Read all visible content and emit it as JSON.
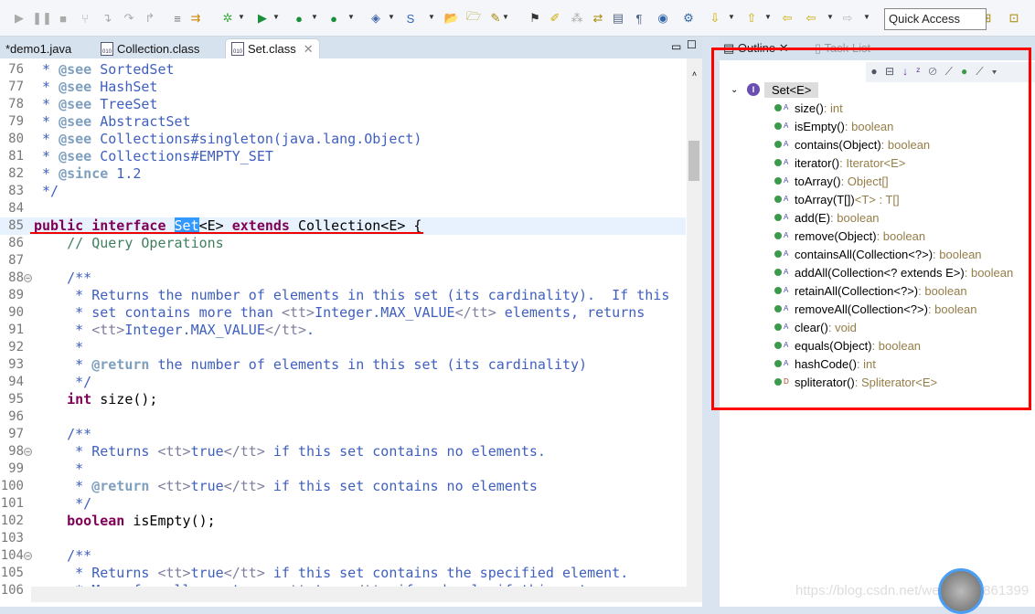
{
  "toolbar": {
    "quick_access": "Quick Access"
  },
  "editor_tabs": [
    {
      "label": "*demo1.java"
    },
    {
      "label": "Collection.class"
    },
    {
      "label": "Set.class",
      "active": true
    }
  ],
  "outline": {
    "tab_outline": "Outline",
    "tab_tasks": "Task List",
    "root": "Set<E>",
    "methods": [
      {
        "name": "size()",
        "ret": " : int"
      },
      {
        "name": "isEmpty()",
        "ret": " : boolean"
      },
      {
        "name": "contains(Object)",
        "ret": " : boolean"
      },
      {
        "name": "iterator()",
        "ret": " : Iterator<E>"
      },
      {
        "name": "toArray()",
        "ret": " : Object[]"
      },
      {
        "name": "toArray(T[])",
        "ret": " <T> : T[]"
      },
      {
        "name": "add(E)",
        "ret": " : boolean"
      },
      {
        "name": "remove(Object)",
        "ret": " : boolean"
      },
      {
        "name": "containsAll(Collection<?>)",
        "ret": " : boolean"
      },
      {
        "name": "addAll(Collection<? extends E>)",
        "ret": " : boolean"
      },
      {
        "name": "retainAll(Collection<?>)",
        "ret": " : boolean"
      },
      {
        "name": "removeAll(Collection<?>)",
        "ret": " : boolean"
      },
      {
        "name": "clear()",
        "ret": " : void"
      },
      {
        "name": "equals(Object)",
        "ret": " : boolean"
      },
      {
        "name": "hashCode()",
        "ret": " : int"
      },
      {
        "name": "spliterator()",
        "ret": " : Spliterator<E>",
        "default": true
      }
    ]
  },
  "code": [
    {
      "n": "76",
      "s": [
        [
          "c",
          " * "
        ],
        [
          "g",
          "@see"
        ],
        [
          "c",
          " SortedSet"
        ]
      ]
    },
    {
      "n": "77",
      "s": [
        [
          "c",
          " * "
        ],
        [
          "g",
          "@see"
        ],
        [
          "c",
          " HashSet"
        ]
      ]
    },
    {
      "n": "78",
      "s": [
        [
          "c",
          " * "
        ],
        [
          "g",
          "@see"
        ],
        [
          "c",
          " TreeSet"
        ]
      ]
    },
    {
      "n": "79",
      "s": [
        [
          "c",
          " * "
        ],
        [
          "g",
          "@see"
        ],
        [
          "c",
          " AbstractSet"
        ]
      ]
    },
    {
      "n": "80",
      "s": [
        [
          "c",
          " * "
        ],
        [
          "g",
          "@see"
        ],
        [
          "c",
          " Collections#singleton(java.lang.Object)"
        ]
      ]
    },
    {
      "n": "81",
      "s": [
        [
          "c",
          " * "
        ],
        [
          "g",
          "@see"
        ],
        [
          "c",
          " Collections#EMPTY_SET"
        ]
      ]
    },
    {
      "n": "82",
      "s": [
        [
          "c",
          " * "
        ],
        [
          "g",
          "@since"
        ],
        [
          "c",
          " 1.2"
        ]
      ]
    },
    {
      "n": "83",
      "s": [
        [
          "c",
          " */"
        ]
      ]
    },
    {
      "n": "84",
      "s": []
    },
    {
      "n": "85",
      "cur": true,
      "s": [
        [
          "k",
          "public"
        ],
        [
          "t",
          " "
        ],
        [
          "k",
          "interface"
        ],
        [
          "t",
          " "
        ],
        [
          "sel",
          "Set"
        ],
        [
          "t",
          "<E> "
        ],
        [
          "k",
          "extends"
        ],
        [
          "t",
          " Collection<E> {"
        ]
      ]
    },
    {
      "n": "86",
      "s": [
        [
          "lc",
          "    // Query Operations"
        ]
      ]
    },
    {
      "n": "87",
      "s": []
    },
    {
      "n": "88",
      "fold": true,
      "s": [
        [
          "c",
          "    /**"
        ]
      ]
    },
    {
      "n": "89",
      "s": [
        [
          "c",
          "     * Returns the number of elements in this set (its cardinality).  If this"
        ]
      ]
    },
    {
      "n": "90",
      "s": [
        [
          "c",
          "     * set contains more than "
        ],
        [
          "h",
          "<tt>"
        ],
        [
          "c",
          "Integer.MAX_VALUE"
        ],
        [
          "h",
          "</tt>"
        ],
        [
          "c",
          " elements, returns"
        ]
      ]
    },
    {
      "n": "91",
      "s": [
        [
          "c",
          "     * "
        ],
        [
          "h",
          "<tt>"
        ],
        [
          "c",
          "Integer.MAX_VALUE"
        ],
        [
          "h",
          "</tt>"
        ],
        [
          "c",
          "."
        ]
      ]
    },
    {
      "n": "92",
      "s": [
        [
          "c",
          "     *"
        ]
      ]
    },
    {
      "n": "93",
      "s": [
        [
          "c",
          "     * "
        ],
        [
          "g",
          "@return"
        ],
        [
          "c",
          " the number of elements in this set (its cardinality)"
        ]
      ]
    },
    {
      "n": "94",
      "s": [
        [
          "c",
          "     */"
        ]
      ]
    },
    {
      "n": "95",
      "s": [
        [
          "t",
          "    "
        ],
        [
          "k",
          "int"
        ],
        [
          "t",
          " size();"
        ]
      ]
    },
    {
      "n": "96",
      "s": []
    },
    {
      "n": "97",
      "s": [
        [
          "c",
          "    /**"
        ]
      ]
    },
    {
      "n": "98",
      "fold": true,
      "s": [
        [
          "c",
          "     * Returns "
        ],
        [
          "h",
          "<tt>"
        ],
        [
          "c",
          "true"
        ],
        [
          "h",
          "</tt>"
        ],
        [
          "c",
          " if this set contains no elements."
        ]
      ]
    },
    {
      "n": "99",
      "s": [
        [
          "c",
          "     *"
        ]
      ]
    },
    {
      "n": "100",
      "s": [
        [
          "c",
          "     * "
        ],
        [
          "g",
          "@return"
        ],
        [
          "c",
          " "
        ],
        [
          "h",
          "<tt>"
        ],
        [
          "c",
          "true"
        ],
        [
          "h",
          "</tt>"
        ],
        [
          "c",
          " if this set contains no elements"
        ]
      ]
    },
    {
      "n": "101",
      "s": [
        [
          "c",
          "     */"
        ]
      ]
    },
    {
      "n": "102",
      "s": [
        [
          "t",
          "    "
        ],
        [
          "k",
          "boolean"
        ],
        [
          "t",
          " isEmpty();"
        ]
      ]
    },
    {
      "n": "103",
      "s": []
    },
    {
      "n": "104",
      "fold": true,
      "s": [
        [
          "c",
          "    /**"
        ]
      ]
    },
    {
      "n": "105",
      "s": [
        [
          "c",
          "     * Returns "
        ],
        [
          "h",
          "<tt>"
        ],
        [
          "c",
          "true"
        ],
        [
          "h",
          "</tt>"
        ],
        [
          "c",
          " if this set contains the specified element."
        ]
      ]
    },
    {
      "n": "106",
      "s": [
        [
          "c",
          "     * More formally, returns "
        ],
        [
          "h",
          "<tt>"
        ],
        [
          "c",
          "true"
        ],
        [
          "h",
          "</tt>"
        ],
        [
          "c",
          " if and only if this set"
        ]
      ]
    }
  ],
  "watermark": "https://blog.csdn.net/weixin_44861399"
}
